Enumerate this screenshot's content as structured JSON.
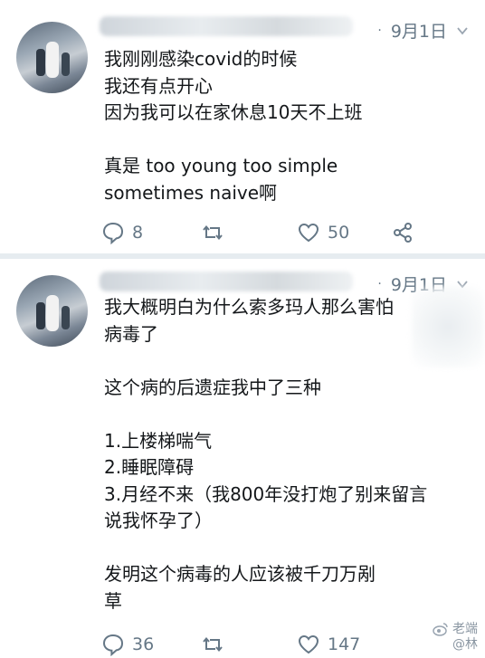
{
  "tweets": [
    {
      "date": "9月1日",
      "text": "我刚刚感染covid的时候\n我还有点开心\n因为我可以在家休息10天不上班\n\n真是 too young too simple\nsometimes naive啊",
      "replies": "8",
      "retweets": "",
      "likes": "50"
    },
    {
      "date": "9月1日",
      "text": "我大概明白为什么索多玛人那么害怕\n病毒了\n\n这个病的后遗症我中了三种\n\n1.上楼梯喘气\n2.睡眠障碍\n3.月经不来（我800年没打炮了别来留言\n说我怀孕了）\n\n发明这个病毒的人应该被千刀万剐\n草",
      "replies": "36",
      "retweets": "",
      "likes": "147"
    }
  ],
  "watermark": {
    "line1": "老端",
    "line2": "@林"
  },
  "icons": [
    "reply-icon",
    "retweet-icon",
    "like-icon",
    "share-icon",
    "chevron-down-icon",
    "weibo-logo-icon"
  ],
  "colors": {
    "secondary_text": "#657786",
    "divider": "#e6ecf0"
  }
}
